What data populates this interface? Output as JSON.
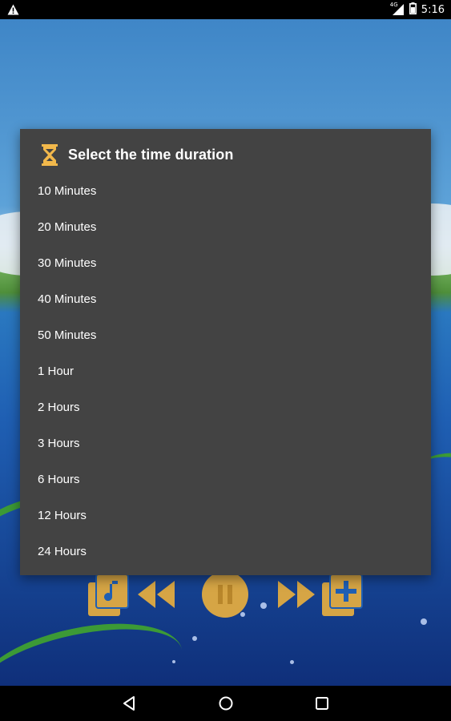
{
  "status_bar": {
    "time": "5:16",
    "network": "4G",
    "icons": [
      "warning-icon",
      "signal-icon",
      "battery-icon"
    ]
  },
  "dialog": {
    "icon": "hourglass-icon",
    "title": "Select the time duration",
    "options": [
      "10 Minutes",
      "20 Minutes",
      "30 Minutes",
      "40 Minutes",
      "50 Minutes",
      "1 Hour",
      "2 Hours",
      "3 Hours",
      "6 Hours",
      "12 Hours",
      "24 Hours"
    ]
  },
  "player_controls": {
    "icons": [
      "playlist-icon",
      "rewind-icon",
      "pause-icon",
      "fast-forward-icon",
      "add-playlist-icon"
    ]
  },
  "nav_bar": {
    "icons": [
      "back-icon",
      "home-icon",
      "recents-icon"
    ]
  },
  "colors": {
    "dialog_bg": "#434343",
    "accent_gold": "#d6a545",
    "hourglass": "#f2b84b"
  }
}
